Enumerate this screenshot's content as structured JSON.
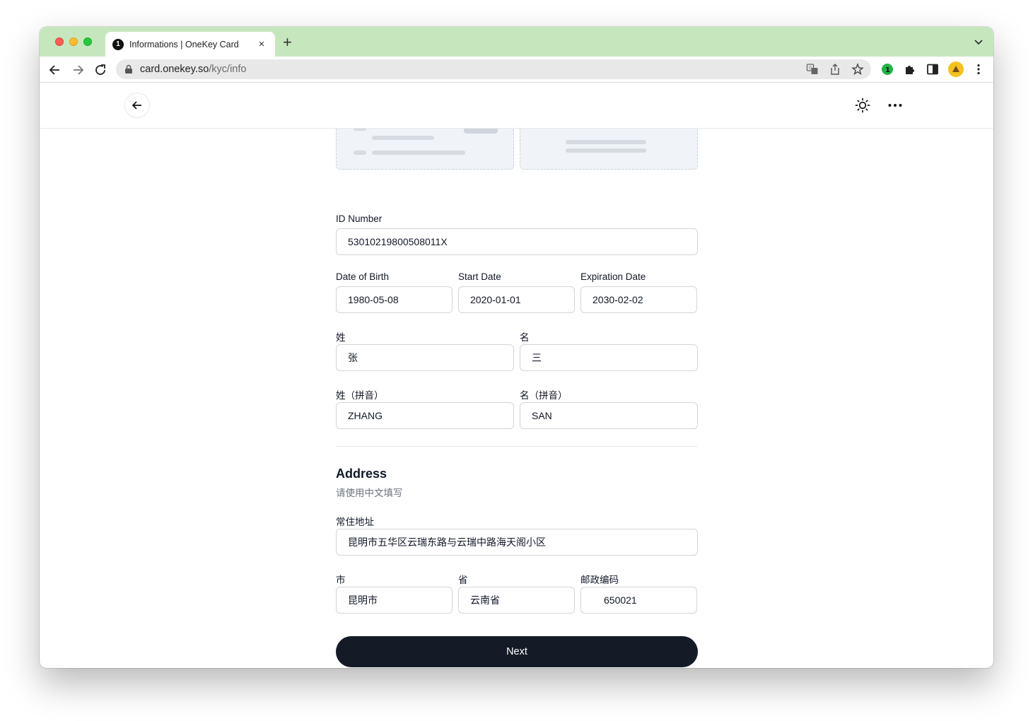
{
  "browser": {
    "tab_title": "Informations | OneKey Card",
    "tab_favicon": "onekey-logo-icon",
    "tab_close": "×",
    "new_tab": "+",
    "url_host": "card.onekey.so",
    "url_path": "/kyc/info",
    "colors": {
      "tabbar": "#c6e7be",
      "omnibox": "#e8e8e8"
    }
  },
  "form": {
    "id_number": {
      "label": "ID Number",
      "value": "53010219800508011X"
    },
    "date_of_birth": {
      "label": "Date of Birth",
      "value": "1980-05-08"
    },
    "start_date": {
      "label": "Start Date",
      "value": "2020-01-01"
    },
    "expiration_date": {
      "label": "Expiration Date",
      "value": "2030-02-02"
    },
    "surname": {
      "label": "姓",
      "value": "张"
    },
    "given_name": {
      "label": "名",
      "value": "三"
    },
    "surname_pinyin": {
      "label": "姓（拼音）",
      "value": "ZHANG"
    },
    "given_name_pinyin": {
      "label": "名（拼音）",
      "value": "SAN"
    }
  },
  "address": {
    "title": "Address",
    "subtitle": "请使用中文填写",
    "residence": {
      "label": "常住地址",
      "value": "昆明市五华区云瑞东路与云瑞中路海天阁小区"
    },
    "city": {
      "label": "市",
      "value": "昆明市"
    },
    "province": {
      "label": "省",
      "value": "云南省"
    },
    "postal_code": {
      "label": "邮政编码",
      "value": "650021"
    }
  },
  "actions": {
    "next_label": "Next",
    "button_color": "#141b26"
  }
}
